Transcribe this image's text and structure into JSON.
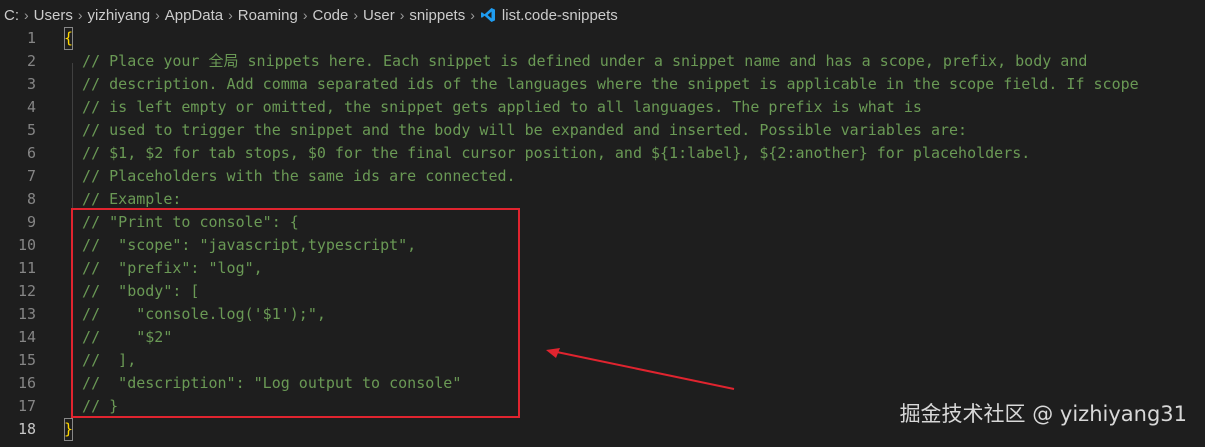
{
  "breadcrumb": {
    "items": [
      "C:",
      "Users",
      "yizhiyang",
      "AppData",
      "Roaming",
      "Code",
      "User",
      "snippets"
    ],
    "file": "list.code-snippets"
  },
  "editor": {
    "active_line": 18,
    "lines": [
      {
        "num": "1",
        "text": "{"
      },
      {
        "num": "2",
        "text": "  // Place your 全局 snippets here. Each snippet is defined under a snippet name and has a scope, prefix, body and"
      },
      {
        "num": "3",
        "text": "  // description. Add comma separated ids of the languages where the snippet is applicable in the scope field. If scope"
      },
      {
        "num": "4",
        "text": "  // is left empty or omitted, the snippet gets applied to all languages. The prefix is what is"
      },
      {
        "num": "5",
        "text": "  // used to trigger the snippet and the body will be expanded and inserted. Possible variables are:"
      },
      {
        "num": "6",
        "text": "  // $1, $2 for tab stops, $0 for the final cursor position, and ${1:label}, ${2:another} for placeholders."
      },
      {
        "num": "7",
        "text": "  // Placeholders with the same ids are connected."
      },
      {
        "num": "8",
        "text": "  // Example:"
      },
      {
        "num": "9",
        "text": "  // \"Print to console\": {"
      },
      {
        "num": "10",
        "text": "  //  \"scope\": \"javascript,typescript\","
      },
      {
        "num": "11",
        "text": "  //  \"prefix\": \"log\","
      },
      {
        "num": "12",
        "text": "  //  \"body\": ["
      },
      {
        "num": "13",
        "text": "  //    \"console.log('$1');\","
      },
      {
        "num": "14",
        "text": "  //    \"$2\""
      },
      {
        "num": "15",
        "text": "  //  ],"
      },
      {
        "num": "16",
        "text": "  //  \"description\": \"Log output to console\""
      },
      {
        "num": "17",
        "text": "  // }"
      },
      {
        "num": "18",
        "text": "}"
      }
    ]
  },
  "watermark": "掘金技术社区 @ yizhiyang31",
  "colors": {
    "background": "#1e1e1e",
    "comment": "#6a9955",
    "brace": "#ffd700",
    "line_number": "#858585",
    "annotation": "#e0242f"
  }
}
